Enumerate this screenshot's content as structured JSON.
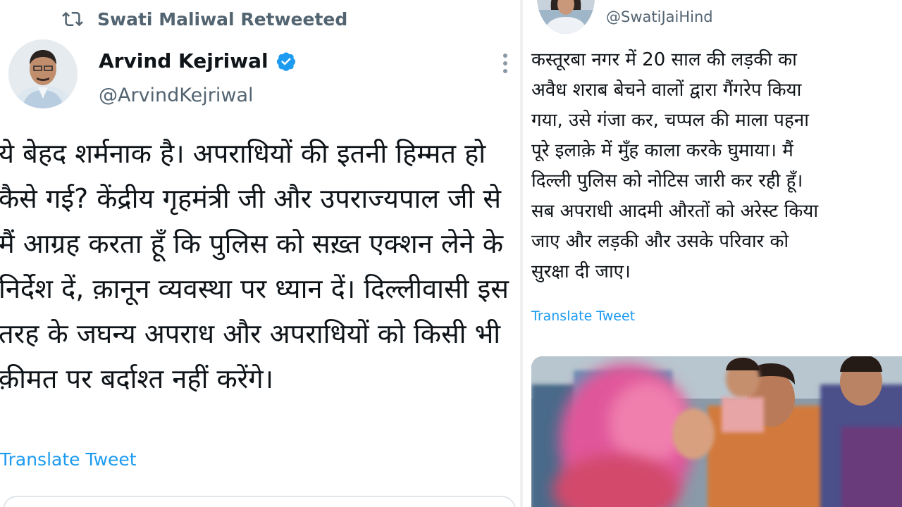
{
  "left_tweet": {
    "retweet_header": "Swati Maliwal Retweeted",
    "author": {
      "name": "Arvind Kejriwal",
      "handle": "@ArvindKejriwal",
      "verified": true
    },
    "text": "ये बेहद शर्मनाक है। अपराधियों की इतनी हिम्मत हो कैसे गई? केंद्रीय गृहमंत्री जी और उपराज्यपाल जी से मैं आग्रह करता हूँ कि पुलिस को सख़्त एक्शन लेने के निर्देश दें, क़ानून व्यवस्था पर ध्यान दें। दिल्लीवासी इस तरह के जघन्य अपराध और अपराधियों को किसी भी क़ीमत पर बर्दाश्त नहीं करेंगे।",
    "translate_label": "Translate Tweet"
  },
  "right_tweet": {
    "author": {
      "handle": "@SwatiJaiHind"
    },
    "text": "कस्तूरबा नगर में 20 साल की लड़की का\nअवैध शराब बेचने वालों द्वारा गैंगरेप किया\nगया, उसे गंजा कर, चप्पल की माला पहना\nपूरे इलाक़े में मुँह काला करके घुमाया। मैं\nदिल्ली पुलिस को नोटिस जारी कर रही हूँ।\nसब अपराधी आदमी औरतों को अरेस्ट किया\nजाए और लड़की और उसके परिवार को\nसुरक्षा दी जाए।",
    "translate_label": "Translate Tweet"
  },
  "colors": {
    "text": "#0f1419",
    "secondary": "#536471",
    "link": "#1d9bf0",
    "verified": "#1d9bf0",
    "divider": "#eef0f2"
  },
  "icons": [
    "retweet-icon",
    "verified-badge-icon",
    "more-options-icon"
  ]
}
